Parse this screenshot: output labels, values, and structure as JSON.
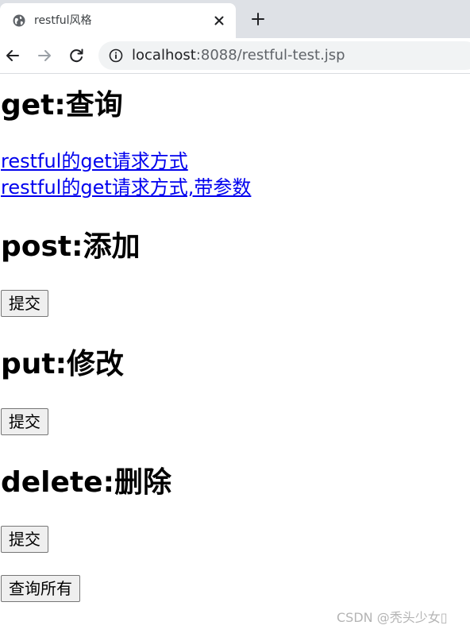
{
  "browser": {
    "tab_title": "restful风格",
    "url_host": "localhost",
    "url_path": ":8088/restful-test.jsp"
  },
  "page": {
    "get_heading": "get:查询",
    "get_link_1": "restful的get请求方式",
    "get_link_2": "restful的get请求方式,带参数",
    "post_heading": "post:添加",
    "post_button": "提交",
    "put_heading": "put:修改",
    "put_button": "提交",
    "delete_heading": "delete:删除",
    "delete_button": "提交",
    "query_all_button": "查询所有"
  },
  "watermark": "CSDN @秃头少女▯"
}
